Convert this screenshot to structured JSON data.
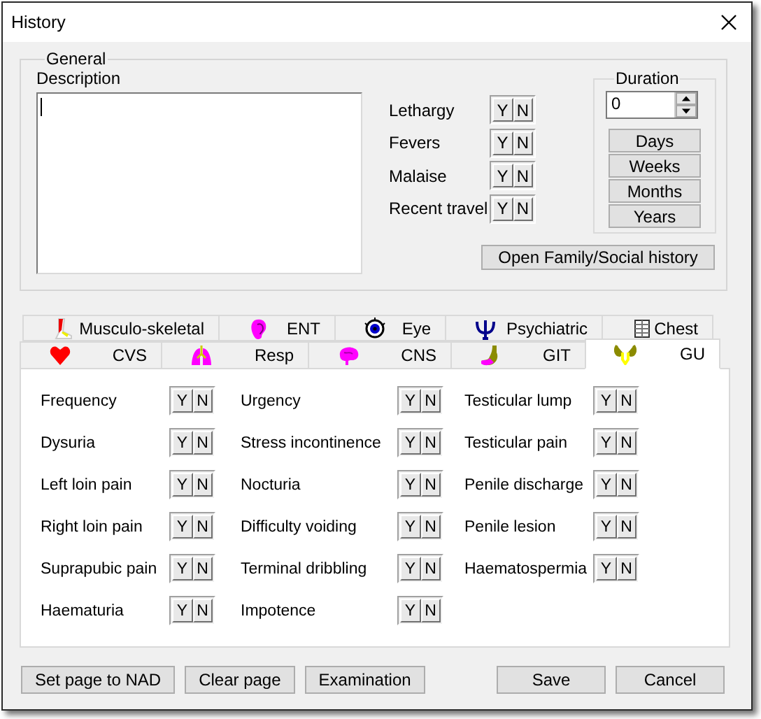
{
  "window": {
    "title": "History"
  },
  "general": {
    "title": "General",
    "description_label": "Description",
    "symptoms": [
      {
        "label": "Lethargy",
        "yes": "Y",
        "no": "N"
      },
      {
        "label": "Fevers",
        "yes": "Y",
        "no": "N"
      },
      {
        "label": "Malaise",
        "yes": "Y",
        "no": "N"
      },
      {
        "label": "Recent travel",
        "yes": "Y",
        "no": "N"
      }
    ],
    "duration": {
      "title": "Duration",
      "value": "0",
      "units": [
        "Days",
        "Weeks",
        "Months",
        "Years"
      ]
    },
    "family_button": "Open Family/Social history"
  },
  "tab_rows": [
    [
      {
        "label": "Musculo-skeletal",
        "selected": false
      },
      {
        "label": "ENT",
        "selected": false
      },
      {
        "label": "Eye",
        "selected": false
      },
      {
        "label": "Psychiatric",
        "selected": false
      },
      {
        "label": "Chest",
        "selected": false
      }
    ],
    [
      {
        "label": "CVS",
        "selected": false
      },
      {
        "label": "Resp",
        "selected": false
      },
      {
        "label": "CNS",
        "selected": false
      },
      {
        "label": "GIT",
        "selected": false
      },
      {
        "label": "GU",
        "selected": true
      }
    ]
  ],
  "gu_columns": [
    [
      {
        "label": "Frequency",
        "yes": "Y",
        "no": "N"
      },
      {
        "label": "Dysuria",
        "yes": "Y",
        "no": "N"
      },
      {
        "label": "Left loin pain",
        "yes": "Y",
        "no": "N"
      },
      {
        "label": "Right loin pain",
        "yes": "Y",
        "no": "N"
      },
      {
        "label": "Suprapubic pain",
        "yes": "Y",
        "no": "N"
      },
      {
        "label": "Haematuria",
        "yes": "Y",
        "no": "N"
      }
    ],
    [
      {
        "label": "Urgency",
        "yes": "Y",
        "no": "N"
      },
      {
        "label": "Stress incontinence",
        "yes": "Y",
        "no": "N"
      },
      {
        "label": "Nocturia",
        "yes": "Y",
        "no": "N"
      },
      {
        "label": "Difficulty voiding",
        "yes": "Y",
        "no": "N"
      },
      {
        "label": "Terminal dribbling",
        "yes": "Y",
        "no": "N"
      },
      {
        "label": "Impotence",
        "yes": "Y",
        "no": "N"
      }
    ],
    [
      {
        "label": "Testicular lump",
        "yes": "Y",
        "no": "N"
      },
      {
        "label": "Testicular pain",
        "yes": "Y",
        "no": "N"
      },
      {
        "label": "Penile discharge",
        "yes": "Y",
        "no": "N"
      },
      {
        "label": "Penile lesion",
        "yes": "Y",
        "no": "N"
      },
      {
        "label": "Haematospermia",
        "yes": "Y",
        "no": "N"
      }
    ]
  ],
  "footer": {
    "left_buttons": [
      "Set page to NAD",
      "Clear page",
      "Examination"
    ],
    "right_buttons": [
      "Save",
      "Cancel"
    ]
  }
}
